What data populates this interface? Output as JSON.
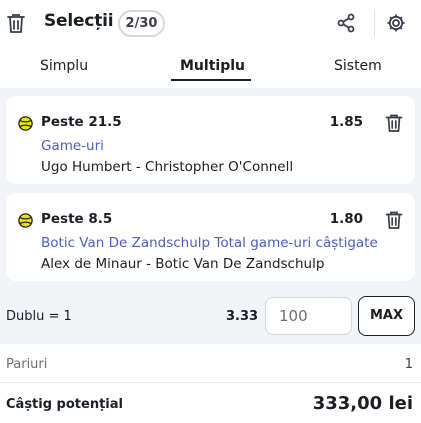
{
  "header": {
    "title": "Selecții",
    "count_badge": "2/30",
    "icons": {
      "trash": "trash-icon",
      "share": "share-icon",
      "settings": "gear-icon"
    }
  },
  "tabs": [
    {
      "label": "Simplu",
      "active": false
    },
    {
      "label": "Multiplu",
      "active": true
    },
    {
      "label": "Sistem",
      "active": false
    }
  ],
  "selections": [
    {
      "market": "Peste 21.5",
      "odds": "1.85",
      "bet_type": "Game-uri",
      "event": "Ugo Humbert - Christopher O'Connell",
      "sport_icon": "tennis-ball-icon"
    },
    {
      "market": "Peste 8.5",
      "odds": "1.80",
      "bet_type": "Botic Van De Zandschulp Total game-uri câștigate",
      "event": "Alex de Minaur - Botic Van De Zandschulp",
      "sport_icon": "tennis-ball-icon"
    }
  ],
  "stake": {
    "label": "Dublu = 1",
    "total_odds": "3.33",
    "amount": "100",
    "max_label": "MAX"
  },
  "summary": {
    "bets_label": "Pariuri",
    "bets_count": "1",
    "potential_win_label": "Câștig potențial",
    "potential_win_value": "333,00 lei"
  },
  "colors": {
    "accent_link": "#4a5fc1",
    "tennis_ball": "#e3e600",
    "background": "#f3f4f8"
  }
}
